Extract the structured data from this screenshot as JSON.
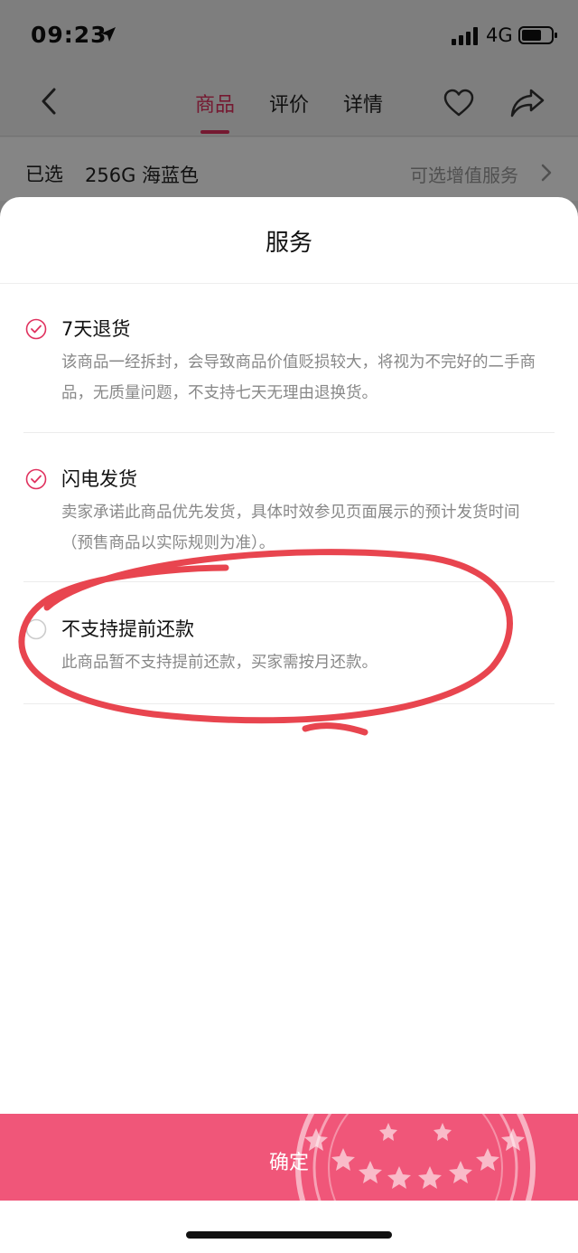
{
  "status_bar": {
    "time": "09:23",
    "network": "4G",
    "icons": [
      "location-arrow-icon",
      "signal-bars-icon",
      "battery-icon"
    ]
  },
  "nav": {
    "back_icon": "chevron-left-icon",
    "tabs": [
      {
        "label": "商品",
        "active": true
      },
      {
        "label": "评价",
        "active": false
      },
      {
        "label": "详情",
        "active": false
      }
    ],
    "right_icons": [
      "heart-icon",
      "share-icon"
    ]
  },
  "selection": {
    "label": "已选",
    "value": "256G 海蓝色",
    "link": "可选增值服务"
  },
  "sheet": {
    "title": "服务",
    "items": [
      {
        "title": "7天退货",
        "desc": "该商品一经拆封，会导致商品价值贬损较大，将视为不完好的二手商品，无质量问题，不支持七天无理由退换货。",
        "checked": true
      },
      {
        "title": "闪电发货",
        "desc": "卖家承诺此商品优先发货，具体时效参见页面展示的预计发货时间（预售商品以实际规则为准）。",
        "checked": true
      },
      {
        "title": "不支持提前还款",
        "desc": "此商品暂不支持提前还款，买家需按月还款。",
        "checked": false
      }
    ],
    "confirm_label": "确定"
  },
  "colors": {
    "accent": "#e0315e",
    "confirm_bg": "#f05679",
    "annotation": "#e8454f"
  }
}
